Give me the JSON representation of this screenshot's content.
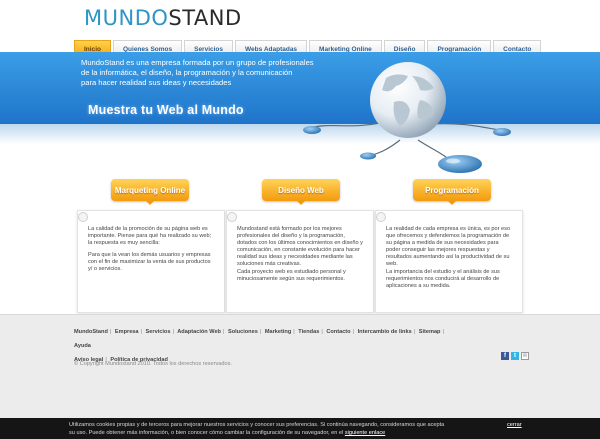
{
  "logo": {
    "part1": "MUNDO",
    "part2": "STAND"
  },
  "nav": [
    {
      "label": "Inicio",
      "active": true
    },
    {
      "label": "Quienes Somos"
    },
    {
      "label": "Servicios"
    },
    {
      "label": "Webs Adaptadas"
    },
    {
      "label": "Marketing Online"
    },
    {
      "label": "Diseño"
    },
    {
      "label": "Programación"
    },
    {
      "label": "Contacto"
    }
  ],
  "hero": {
    "line1": "MundoStand es una empresa formada por un grupo de profesionales",
    "line2": "de la informática, el diseño, la programación y la comunicación",
    "line3": "para hacer realidad sus ideas y necesidades",
    "tagline": "Muestra tu Web al Mundo"
  },
  "sections": [
    {
      "button": "Marqueting Online",
      "p1": "La calidad de la promoción de su página web es importante. Piense para qué ha realizado su web; la respuesta es muy sencilla:",
      "p2": "Para que la vean los demás usuarios y empresas con el fin de maximizar la venta de sus productos y/ o servicios."
    },
    {
      "button": "Diseño Web",
      "p1": "Mundostand está formado por los mejores profesionales del diseño y la programación, dotados con los últimos conocimientos en diseño y comunicación, en constante evolución para hacer realidad sus ideas y necesidades mediante las soluciones más creativas.",
      "p2": "Cada proyecto web es estudiado personal y minuciosamente según sus requerimientos."
    },
    {
      "button": "Programación",
      "p1": "La realidad de cada empresa es única, es por eso que ofrecemos y defendemos la programación de su página a medida de sus necesidades para poder conseguir las mejores respuestas y resultados aumentando así la productividad de su web.",
      "p2": "La importancia del estudio y el análisis de sus requerimientos nos conducirá al desarrollo de aplicaciones a su medida."
    }
  ],
  "footer": {
    "links": [
      "MundoStand",
      "Empresa",
      "Servicios",
      "Adaptación Web",
      "Soluciones",
      "Marketing",
      "Tiendas",
      "Contacto",
      "Intercambio de links",
      "Sitemap",
      "Ayuda",
      "Aviso legal",
      "Política de privacidad"
    ],
    "copyright": "© Copyright Mundostand 2010. Todos los derechos reservados."
  },
  "social": {
    "facebook": "f",
    "twitter": "t",
    "mail": "✉"
  },
  "cookie": {
    "line1": "Utilizamos cookies propias y de terceros para mejorar nuestros servicios y conocer sus preferencias. Si continúa navegando, consideramos que acepta",
    "line2": "su uso. Puede obtener más información, o bien conocer cómo cambiar la configuración de su navegador, en el ",
    "link": "siguiente enlace",
    "close": "cerrar"
  },
  "colors": {
    "hero_blue": "#1f74c9",
    "accent_orange": "#f39a0c",
    "logo_blue": "#2f94c6"
  }
}
